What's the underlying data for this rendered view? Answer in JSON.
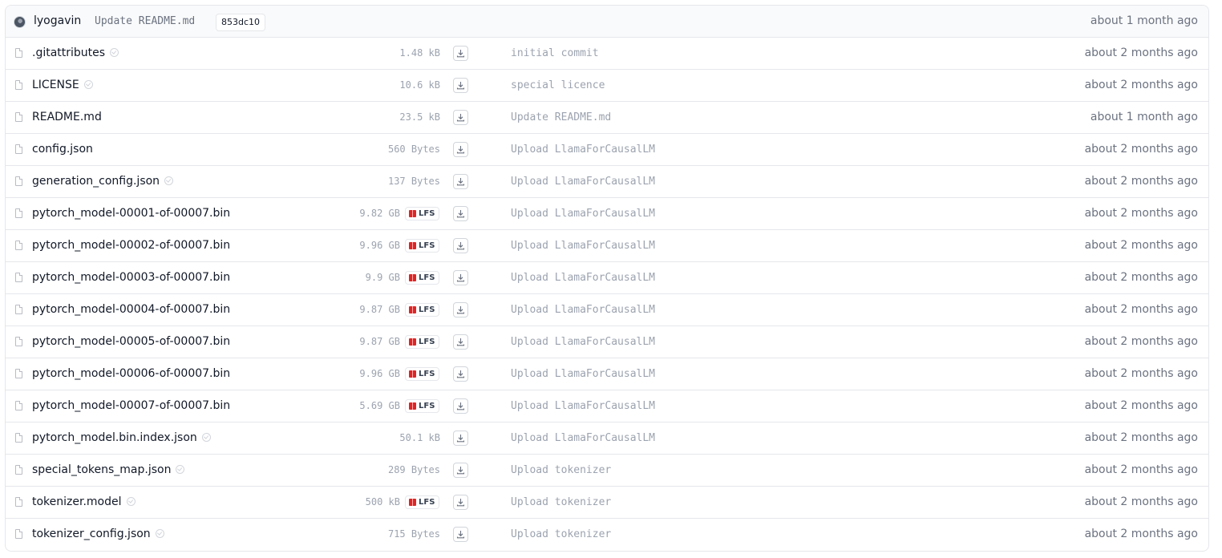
{
  "header": {
    "author": "lyogavin",
    "commit_message": "Update README.md",
    "commit_sha": "853dc10",
    "time": "about 1 month ago"
  },
  "files": [
    {
      "name": ".gitattributes",
      "safe": true,
      "size": "1.48 kB",
      "lfs": false,
      "message": "initial commit",
      "time": "about 2 months ago"
    },
    {
      "name": "LICENSE",
      "safe": true,
      "size": "10.6 kB",
      "lfs": false,
      "message": "special licence",
      "time": "about 2 months ago"
    },
    {
      "name": "README.md",
      "safe": false,
      "size": "23.5 kB",
      "lfs": false,
      "message": "Update README.md",
      "time": "about 1 month ago"
    },
    {
      "name": "config.json",
      "safe": false,
      "size": "560 Bytes",
      "lfs": false,
      "message": "Upload LlamaForCausalLM",
      "time": "about 2 months ago"
    },
    {
      "name": "generation_config.json",
      "safe": true,
      "size": "137 Bytes",
      "lfs": false,
      "message": "Upload LlamaForCausalLM",
      "time": "about 2 months ago"
    },
    {
      "name": "pytorch_model-00001-of-00007.bin",
      "safe": false,
      "size": "9.82 GB",
      "lfs": true,
      "message": "Upload LlamaForCausalLM",
      "time": "about 2 months ago"
    },
    {
      "name": "pytorch_model-00002-of-00007.bin",
      "safe": false,
      "size": "9.96 GB",
      "lfs": true,
      "message": "Upload LlamaForCausalLM",
      "time": "about 2 months ago"
    },
    {
      "name": "pytorch_model-00003-of-00007.bin",
      "safe": false,
      "size": "9.9 GB",
      "lfs": true,
      "message": "Upload LlamaForCausalLM",
      "time": "about 2 months ago"
    },
    {
      "name": "pytorch_model-00004-of-00007.bin",
      "safe": false,
      "size": "9.87 GB",
      "lfs": true,
      "message": "Upload LlamaForCausalLM",
      "time": "about 2 months ago"
    },
    {
      "name": "pytorch_model-00005-of-00007.bin",
      "safe": false,
      "size": "9.87 GB",
      "lfs": true,
      "message": "Upload LlamaForCausalLM",
      "time": "about 2 months ago"
    },
    {
      "name": "pytorch_model-00006-of-00007.bin",
      "safe": false,
      "size": "9.96 GB",
      "lfs": true,
      "message": "Upload LlamaForCausalLM",
      "time": "about 2 months ago"
    },
    {
      "name": "pytorch_model-00007-of-00007.bin",
      "safe": false,
      "size": "5.69 GB",
      "lfs": true,
      "message": "Upload LlamaForCausalLM",
      "time": "about 2 months ago"
    },
    {
      "name": "pytorch_model.bin.index.json",
      "safe": true,
      "size": "50.1 kB",
      "lfs": false,
      "message": "Upload LlamaForCausalLM",
      "time": "about 2 months ago"
    },
    {
      "name": "special_tokens_map.json",
      "safe": true,
      "size": "289 Bytes",
      "lfs": false,
      "message": "Upload tokenizer",
      "time": "about 2 months ago"
    },
    {
      "name": "tokenizer.model",
      "safe": true,
      "size": "500 kB",
      "lfs": true,
      "message": "Upload tokenizer",
      "time": "about 2 months ago"
    },
    {
      "name": "tokenizer_config.json",
      "safe": true,
      "size": "715 Bytes",
      "lfs": false,
      "message": "Upload tokenizer",
      "time": "about 2 months ago"
    }
  ],
  "lfs_label": "LFS"
}
